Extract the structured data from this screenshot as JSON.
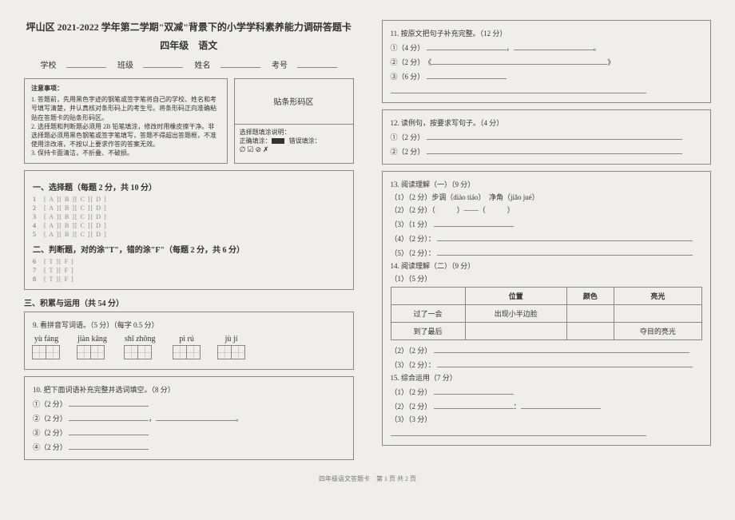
{
  "header": {
    "title": "坪山区 2021-2022 学年第二学期\"双减\"背景下的小学学科素养能力调研答题卡",
    "subtitle": "四年级　语文",
    "school_label": "学校",
    "class_label": "班级",
    "name_label": "姓名",
    "id_label": "考号"
  },
  "notice": {
    "title": "注意事项：",
    "item1": "1. 答题前，先用黑色字迹的钢笔或签字笔将自己的学校、姓名和考号填写清楚，并认真核对条形码上的考生号。将条形码正向准确粘贴在答题卡的贴条形码区。",
    "item2": "2. 选择题和判断题必须用 2B 铅笔填涂，修改时用橡皮擦干净。非选择题必须用黑色钢笔或签字笔填写，答题不得超出答题框，不准使用涂改液，不按以上要求作答的答案无效。",
    "item3": "3. 保持卡面清洁，不折叠、不破损。"
  },
  "barcode": {
    "label": "贴条形码区",
    "fill_title": "选择题填涂说明：",
    "correct": "正确填涂：",
    "wrong": "错误填涂："
  },
  "sec1": {
    "title": "一、选择题（每题 2 分，共 10 分）",
    "opts": "[ A ][ B ][ C ][ D ]"
  },
  "sec2": {
    "title": "二、判断题，对的涂\"T\"，错的涂\"F\"（每题 2 分，共 6 分）",
    "opts": "[ T ][ F ]"
  },
  "sec3": {
    "title": "三、积累与运用（共 54 分）"
  },
  "q9": {
    "title": "9. 看拼音写词语。（5 分）（每字 0.5 分）",
    "p1": "yù fáng",
    "p2": "jiàn kāng",
    "p3": "shī zhōng",
    "p4": "pì rú",
    "p5": "jù jí"
  },
  "q10": {
    "title": "10. 把下面词语补充完整并选词填空。（8 分）",
    "line1": "①（2 分）",
    "line2": "②（2 分）",
    "line3": "③（2 分）",
    "line4": "④（2 分）"
  },
  "q11": {
    "title": "11. 按原文把句子补充完整。（12 分）",
    "line1": "①（4 分）",
    "line2": "②（2 分）　《",
    "line2b": "》",
    "line3": "③（6 分）"
  },
  "q12": {
    "title": "12. 读例句，按要求写句子。（4 分）",
    "l1": "①（2 分）",
    "l2": "②（2 分）"
  },
  "q13": {
    "title": "13. 阅读理解（一）（9 分）",
    "l1": "（1）（2 分）步调（diào tiáo）　净角（jiǎo jué）",
    "l2": "（2）（2 分）（　　　）——（　　　）",
    "l3": "（3）（1 分）",
    "l4": "（4）（2 分）：",
    "l5": "（5）（2 分）："
  },
  "q14": {
    "title": "14. 阅读理解（二）（9 分）",
    "l1": "（1）（5 分）",
    "th1": "位置",
    "th2": "颜色",
    "th3": "亮光",
    "r1c0": "过了一会",
    "r1c1": "出现小半边脸",
    "r2c0": "到了最后",
    "r2c3": "夺目的亮光",
    "l2": "（2）（2 分）",
    "l3": "（3）（2 分）："
  },
  "q15": {
    "title": "15. 综合运用（7 分）",
    "l1": "（1）（2 分）",
    "l2": "（2）（2 分）",
    "l3": "（3）（3 分）"
  },
  "footer": "四年级语文答题卡　第 1 页 共 2 页"
}
